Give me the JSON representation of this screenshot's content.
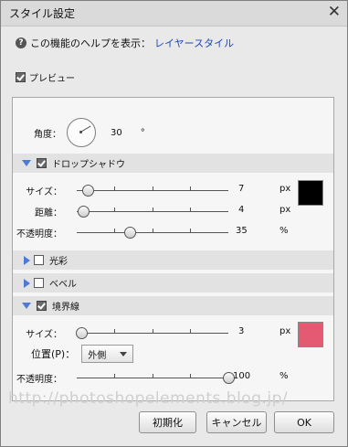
{
  "window": {
    "title": "スタイル設定",
    "close_icon": "close-icon"
  },
  "help": {
    "text": "この機能のヘルプを表示：",
    "link": "レイヤースタイル",
    "icon": "help-question-icon"
  },
  "preview": {
    "label": "プレビュー",
    "checked": true
  },
  "angle": {
    "label": "角度：",
    "value": "30",
    "unit": "°"
  },
  "drop_shadow": {
    "label": "ドロップシャドウ",
    "expanded": true,
    "checked": true,
    "size": {
      "label": "サイズ：",
      "value": "7",
      "unit": "px",
      "fraction": 0.07
    },
    "distance": {
      "label": "距離：",
      "value": "4",
      "unit": "px",
      "fraction": 0.04
    },
    "opacity": {
      "label": "不透明度：",
      "value": "35",
      "unit": "%",
      "fraction": 0.35
    },
    "color": "#000000"
  },
  "outer_glow": {
    "label": "光彩",
    "expanded": false,
    "checked": false
  },
  "bevel": {
    "label": "ベベル",
    "expanded": false,
    "checked": false
  },
  "stroke": {
    "label": "境界線",
    "expanded": true,
    "checked": true,
    "size": {
      "label": "サイズ：",
      "value": "3",
      "unit": "px",
      "fraction": 0.03
    },
    "position": {
      "label": "位置(P)：",
      "selected": "外側"
    },
    "opacity": {
      "label": "不透明度：",
      "value": "100",
      "unit": "%",
      "fraction": 1.0
    },
    "color": "#e35a72"
  },
  "watermark": "http://photoshopelements.blog.jp/",
  "buttons": {
    "reset": "初期化",
    "cancel": "キャンセル",
    "ok": "OK"
  }
}
